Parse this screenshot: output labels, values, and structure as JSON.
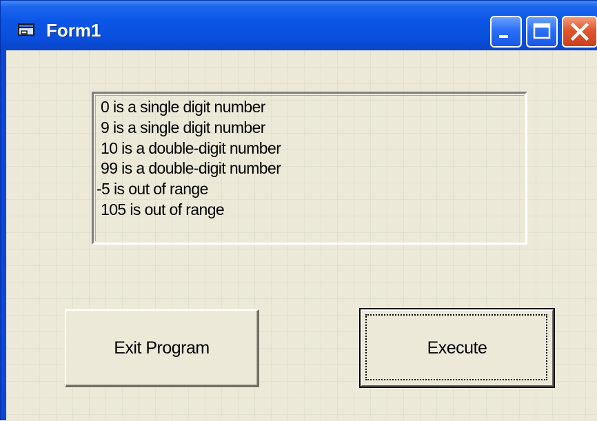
{
  "window": {
    "title": "Form1",
    "icon": "vb-form-icon",
    "controls": {
      "minimize_icon": "minimize-icon",
      "maximize_icon": "maximize-icon",
      "close_icon": "close-icon"
    }
  },
  "listbox": {
    "items": [
      "0 is a single digit number",
      "9 is a single digit number",
      "10 is a double-digit number",
      "99 is a double-digit number",
      "-5 is out of range",
      "105 is out of range"
    ]
  },
  "buttons": {
    "exit_label": "Exit Program",
    "execute_label": "Execute"
  },
  "colors": {
    "titlebar": "#0a56e6",
    "client_background": "#ece9d8",
    "close_button": "#e0562f"
  }
}
